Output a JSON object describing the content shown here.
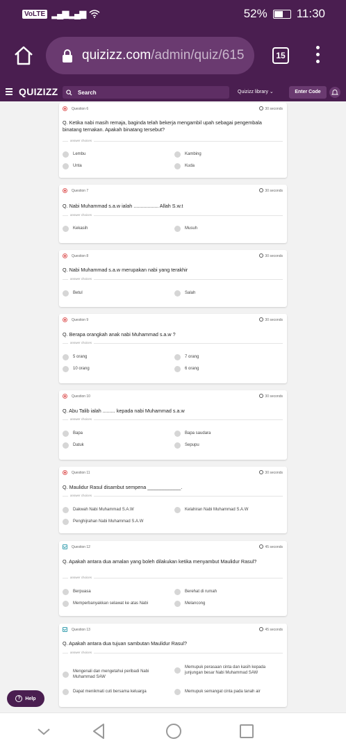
{
  "status_bar": {
    "volte": "VoLTE",
    "signal": "4G",
    "battery": "52%",
    "time": "11:30"
  },
  "browser": {
    "url_host": "quizizz.com",
    "url_path": "/admin/quiz/615",
    "tab_count": "15"
  },
  "app_nav": {
    "logo": "QUIZIZZ",
    "search_placeholder": "Search",
    "library": "Quizizz library",
    "enter_code": "Enter Code"
  },
  "divider_label": "answer choices",
  "questions": [
    {
      "number": "Question 6",
      "time": "30 seconds",
      "text": "Q. Ketika nabi masih remaja, baginda telah bekerja mengambil upah sebagai pengembala binatang ternakan. Apakah binatang tersebut?",
      "options": [
        "Lembu",
        "Kambing",
        "Unta",
        "Kuda"
      ]
    },
    {
      "number": "Question 7",
      "time": "30 seconds",
      "text": "Q. Nabi Muhammad s.a.w ialah .................. Allah S.w.t",
      "options": [
        "Kekasih",
        "Musuh"
      ]
    },
    {
      "number": "Question 8",
      "time": "30 seconds",
      "text": "Q. Nabi Muhammad s.a.w merupakan nabi yang terakhir",
      "options": [
        "Betul",
        "Salah"
      ]
    },
    {
      "number": "Question 9",
      "time": "30 seconds",
      "text": "Q. Berapa orangkah anak nabi Muhammad s.a.w ?",
      "options": [
        "5 orang",
        "7 orang",
        "10 orang",
        "6 orang"
      ]
    },
    {
      "number": "Question 10",
      "time": "30 seconds",
      "text": "Q. Abu Talib ialah ......... kepada nabi Muhammad s.a.w",
      "options": [
        "Bapa",
        "Bapa saudara",
        "Datuk",
        "Sepupu"
      ]
    },
    {
      "number": "Question 11",
      "time": "30 seconds",
      "text": "Q. Maulidur Rasul disambut sempena ____________.",
      "options": [
        "Dakwah Nabi Muhammad S.A.W",
        "Kelahiran Nabi Muhammad S.A.W",
        "Penghijrahan Nabi Muhammad S.A.W"
      ]
    },
    {
      "number": "Question 12",
      "time": "45 seconds",
      "text": "Q. Apakah antara dua amalan yang boleh dilakukan ketika menyambut Maulidur Rasul?",
      "options": [
        "Berpuasa",
        "Berehat di rumah",
        "Memperbanyakkan selawat ke atas Nabi",
        "Melancong"
      ]
    },
    {
      "number": "Question 13",
      "time": "45 seconds",
      "text": "Q. Apakah antara dua tujuan sambutan Maulidur Rasul?",
      "options": [
        "Mengenali dan mengetahui peribadi Nabi Muhammad SAW",
        "Memupuk perasaan cinta dan kasih kepada junjungan besar Nabi Muhammad SAW",
        "Dapat menikmati cuti bersama keluarga",
        "Memupuk semangat cinta pada tanah air"
      ]
    }
  ],
  "help": "Help",
  "colors": {
    "brand": "#4a1e50",
    "brand_light": "#6a3a70"
  },
  "icons": [
    "home-icon",
    "lock-icon",
    "menu-icon",
    "search-icon",
    "bell-icon",
    "clock-icon",
    "radio-icon",
    "back-icon",
    "home-circle-icon",
    "recents-icon"
  ]
}
